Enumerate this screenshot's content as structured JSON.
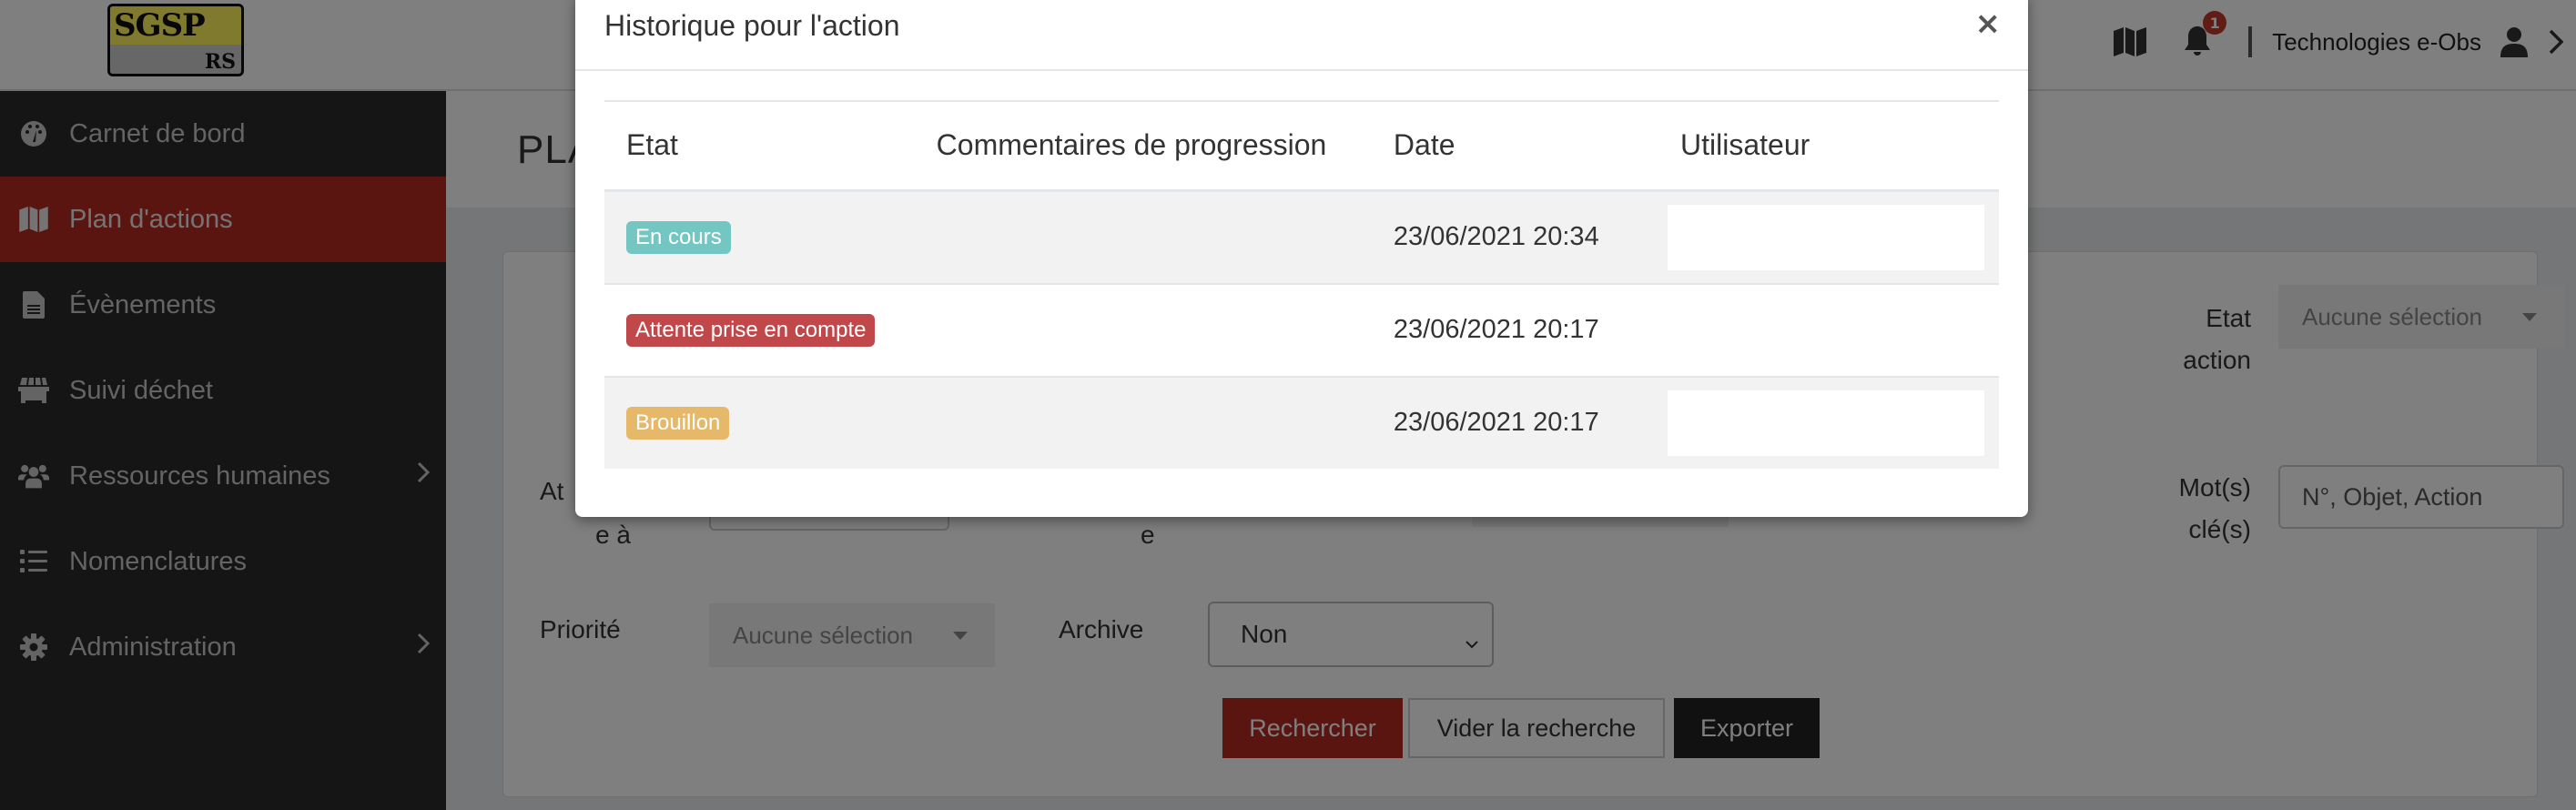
{
  "header": {
    "logo_top": "SGSP",
    "logo_bottom": "RS",
    "notification_count": "1",
    "user_name": "Technologies e-Obs",
    "icons": [
      "map-icon",
      "bell-icon",
      "user-icon",
      "chevron-right-icon"
    ]
  },
  "sidebar": {
    "items": [
      {
        "label": "Carnet de bord",
        "icon": "tachometer-icon",
        "active": false,
        "has_submenu": false
      },
      {
        "label": "Plan d'actions",
        "icon": "map-icon",
        "active": true,
        "has_submenu": false
      },
      {
        "label": "Évènements",
        "icon": "file-icon",
        "active": false,
        "has_submenu": false
      },
      {
        "label": "Suivi déchet",
        "icon": "dumpster-icon",
        "active": false,
        "has_submenu": false
      },
      {
        "label": "Ressources humaines",
        "icon": "users-icon",
        "active": false,
        "has_submenu": true
      },
      {
        "label": "Nomenclatures",
        "icon": "list-icon",
        "active": false,
        "has_submenu": false
      },
      {
        "label": "Administration",
        "icon": "gear-icon",
        "active": false,
        "has_submenu": true
      }
    ]
  },
  "page": {
    "title_partial": "PLA",
    "filters": {
      "etat_action_label_1": "Etat",
      "etat_action_label_2": "action",
      "etat_action_value": "Aucune sélection",
      "assigne_label_partial_1": "At",
      "assigne_label_partial_2": "e à",
      "middle_label_partial": "e",
      "keywords_label_1": "Mot(s)",
      "keywords_label_2": "clé(s)",
      "keywords_placeholder": "N°, Objet, Action",
      "priorite_label": "Priorité",
      "priorite_value": "Aucune sélection",
      "archive_label": "Archive",
      "archive_value": "Non"
    },
    "buttons": {
      "search": "Rechercher",
      "clear": "Vider la recherche",
      "export": "Exporter"
    }
  },
  "modal": {
    "title": "Historique pour l'action",
    "close_label": "×",
    "columns": [
      "Etat",
      "Commentaires de progression",
      "Date",
      "Utilisateur"
    ],
    "rows": [
      {
        "etat": "En cours",
        "etat_color": "#73c6c2",
        "commentaire": "",
        "date": "23/06/2021 20:34",
        "utilisateur": ""
      },
      {
        "etat": "Attente prise en compte",
        "etat_color": "#c0474a",
        "commentaire": "",
        "date": "23/06/2021 20:17",
        "utilisateur": ""
      },
      {
        "etat": "Brouillon",
        "etat_color": "#e6b96a",
        "commentaire": "",
        "date": "23/06/2021 20:17",
        "utilisateur": ""
      }
    ]
  },
  "colors": {
    "accent_red": "#b72a22",
    "sidebar_bg": "#2b2b2b",
    "badge_red": "#c0392b"
  }
}
